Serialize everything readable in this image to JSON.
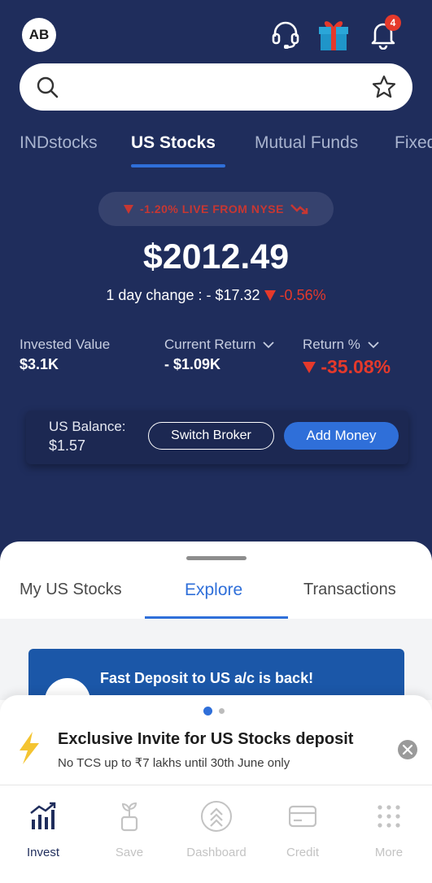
{
  "header": {
    "avatar_initials": "AB",
    "notification_count": "4"
  },
  "search": {
    "placeholder": ""
  },
  "tabs": [
    {
      "label": "INDstocks"
    },
    {
      "label": "US Stocks"
    },
    {
      "label": "Mutual Funds"
    },
    {
      "label": "Fixed"
    }
  ],
  "market": {
    "live_text": "-1.20% LIVE FROM NYSE",
    "portfolio_value": "$2012.49",
    "day_change_label": "1 day change : - $17.32",
    "day_change_pct": "-0.56%"
  },
  "stats": {
    "invested_label": "Invested Value",
    "invested_value": "$3.1K",
    "current_return_label": "Current Return",
    "current_return_value": "- $1.09K",
    "return_pct_label": "Return %",
    "return_pct_value": "-35.08%"
  },
  "balance": {
    "label": "US Balance:",
    "value": "$1.57",
    "switch_label": "Switch Broker",
    "add_label": "Add Money"
  },
  "sheet_tabs": [
    {
      "label": "My US Stocks"
    },
    {
      "label": "Explore"
    },
    {
      "label": "Transactions"
    }
  ],
  "promo": {
    "text": "Fast Deposit to US a/c is back!"
  },
  "invite": {
    "title": "Exclusive Invite for US Stocks deposit",
    "subtitle": "No TCS up to ₹7 lakhs until 30th June only"
  },
  "bottom_nav": [
    {
      "label": "Invest",
      "icon": "invest-icon"
    },
    {
      "label": "Save",
      "icon": "plant-icon"
    },
    {
      "label": "Dashboard",
      "icon": "dashboard-icon"
    },
    {
      "label": "Credit",
      "icon": "credit-card-icon"
    },
    {
      "label": "More",
      "icon": "grid-icon"
    }
  ],
  "colors": {
    "background": "#1f2d5c",
    "accent": "#2f6fd9",
    "negative": "#e5392b"
  }
}
